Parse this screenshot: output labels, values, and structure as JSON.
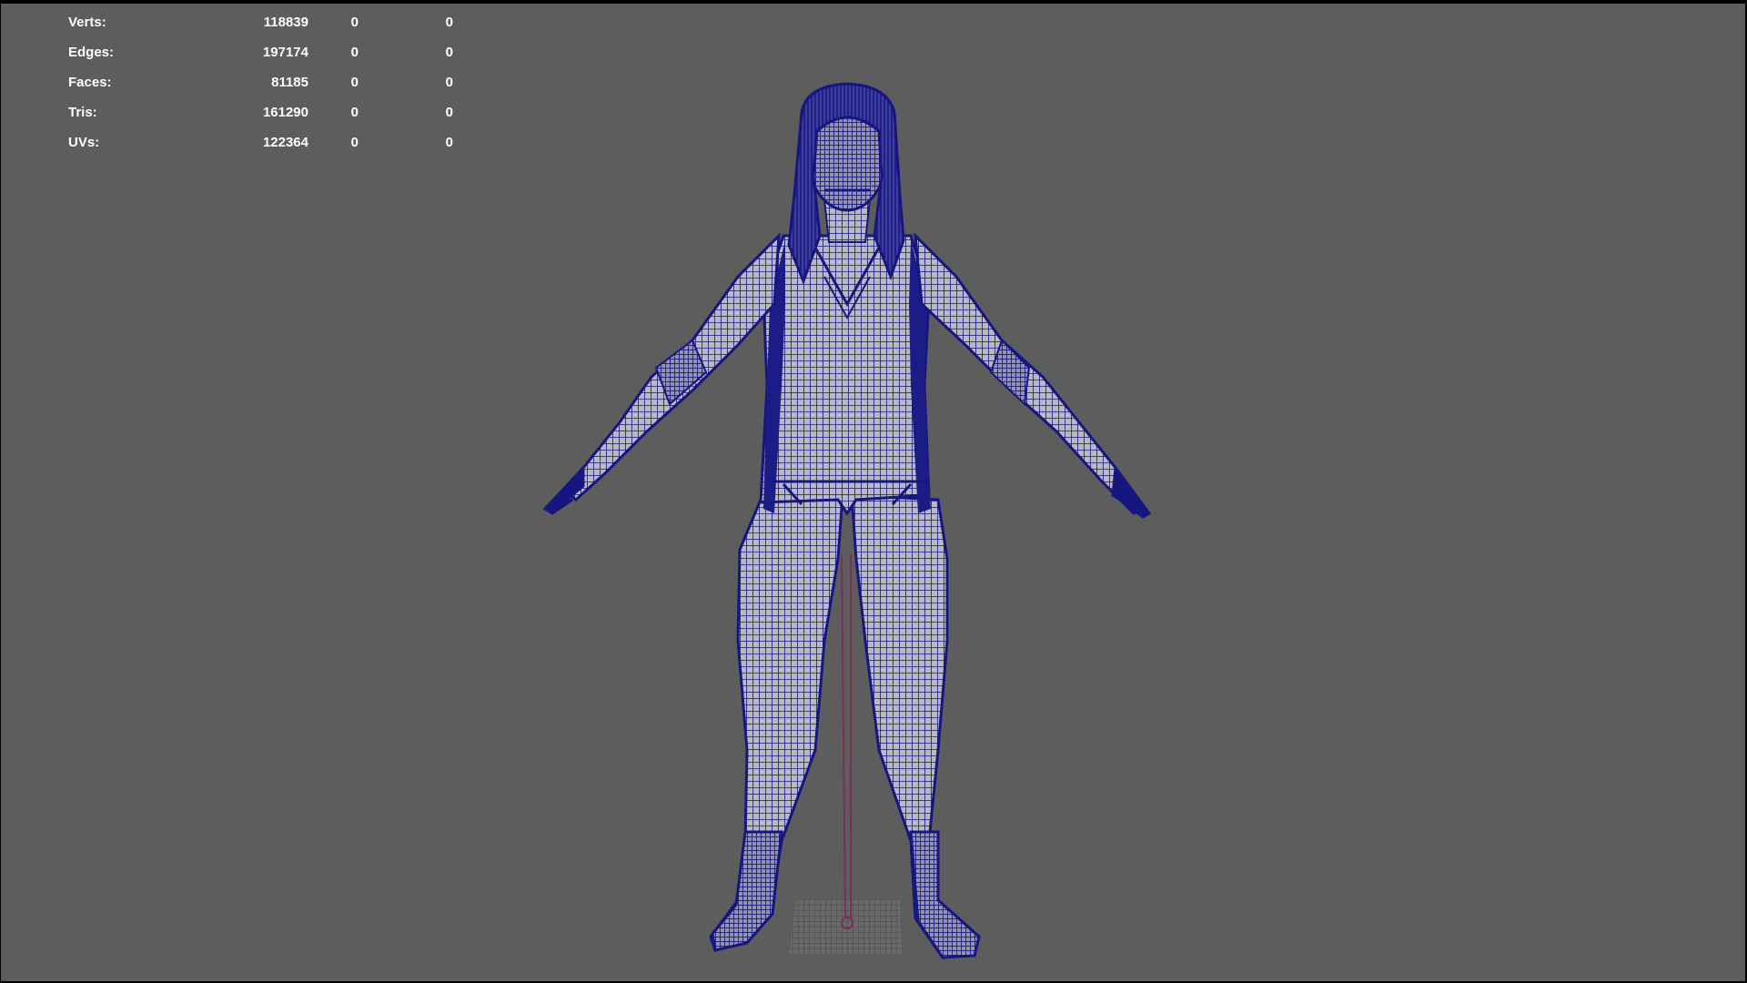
{
  "viewport": {
    "background": "#5d5d5d",
    "wireframe_color": "#161680",
    "joint_color": "#7a2e5a",
    "grid_color": "#4a4a4a"
  },
  "heads_up_display": {
    "rows": [
      {
        "label": "Verts:",
        "total": "118839",
        "selected": "0",
        "components": "0"
      },
      {
        "label": "Edges:",
        "total": "197174",
        "selected": "0",
        "components": "0"
      },
      {
        "label": "Faces:",
        "total": "81185",
        "selected": "0",
        "components": "0"
      },
      {
        "label": "Tris:",
        "total": "161290",
        "selected": "0",
        "components": "0"
      },
      {
        "label": "UVs:",
        "total": "122364",
        "selected": "0",
        "components": "0"
      }
    ]
  },
  "model": {
    "object_icon": "wireframe-character-icon"
  }
}
